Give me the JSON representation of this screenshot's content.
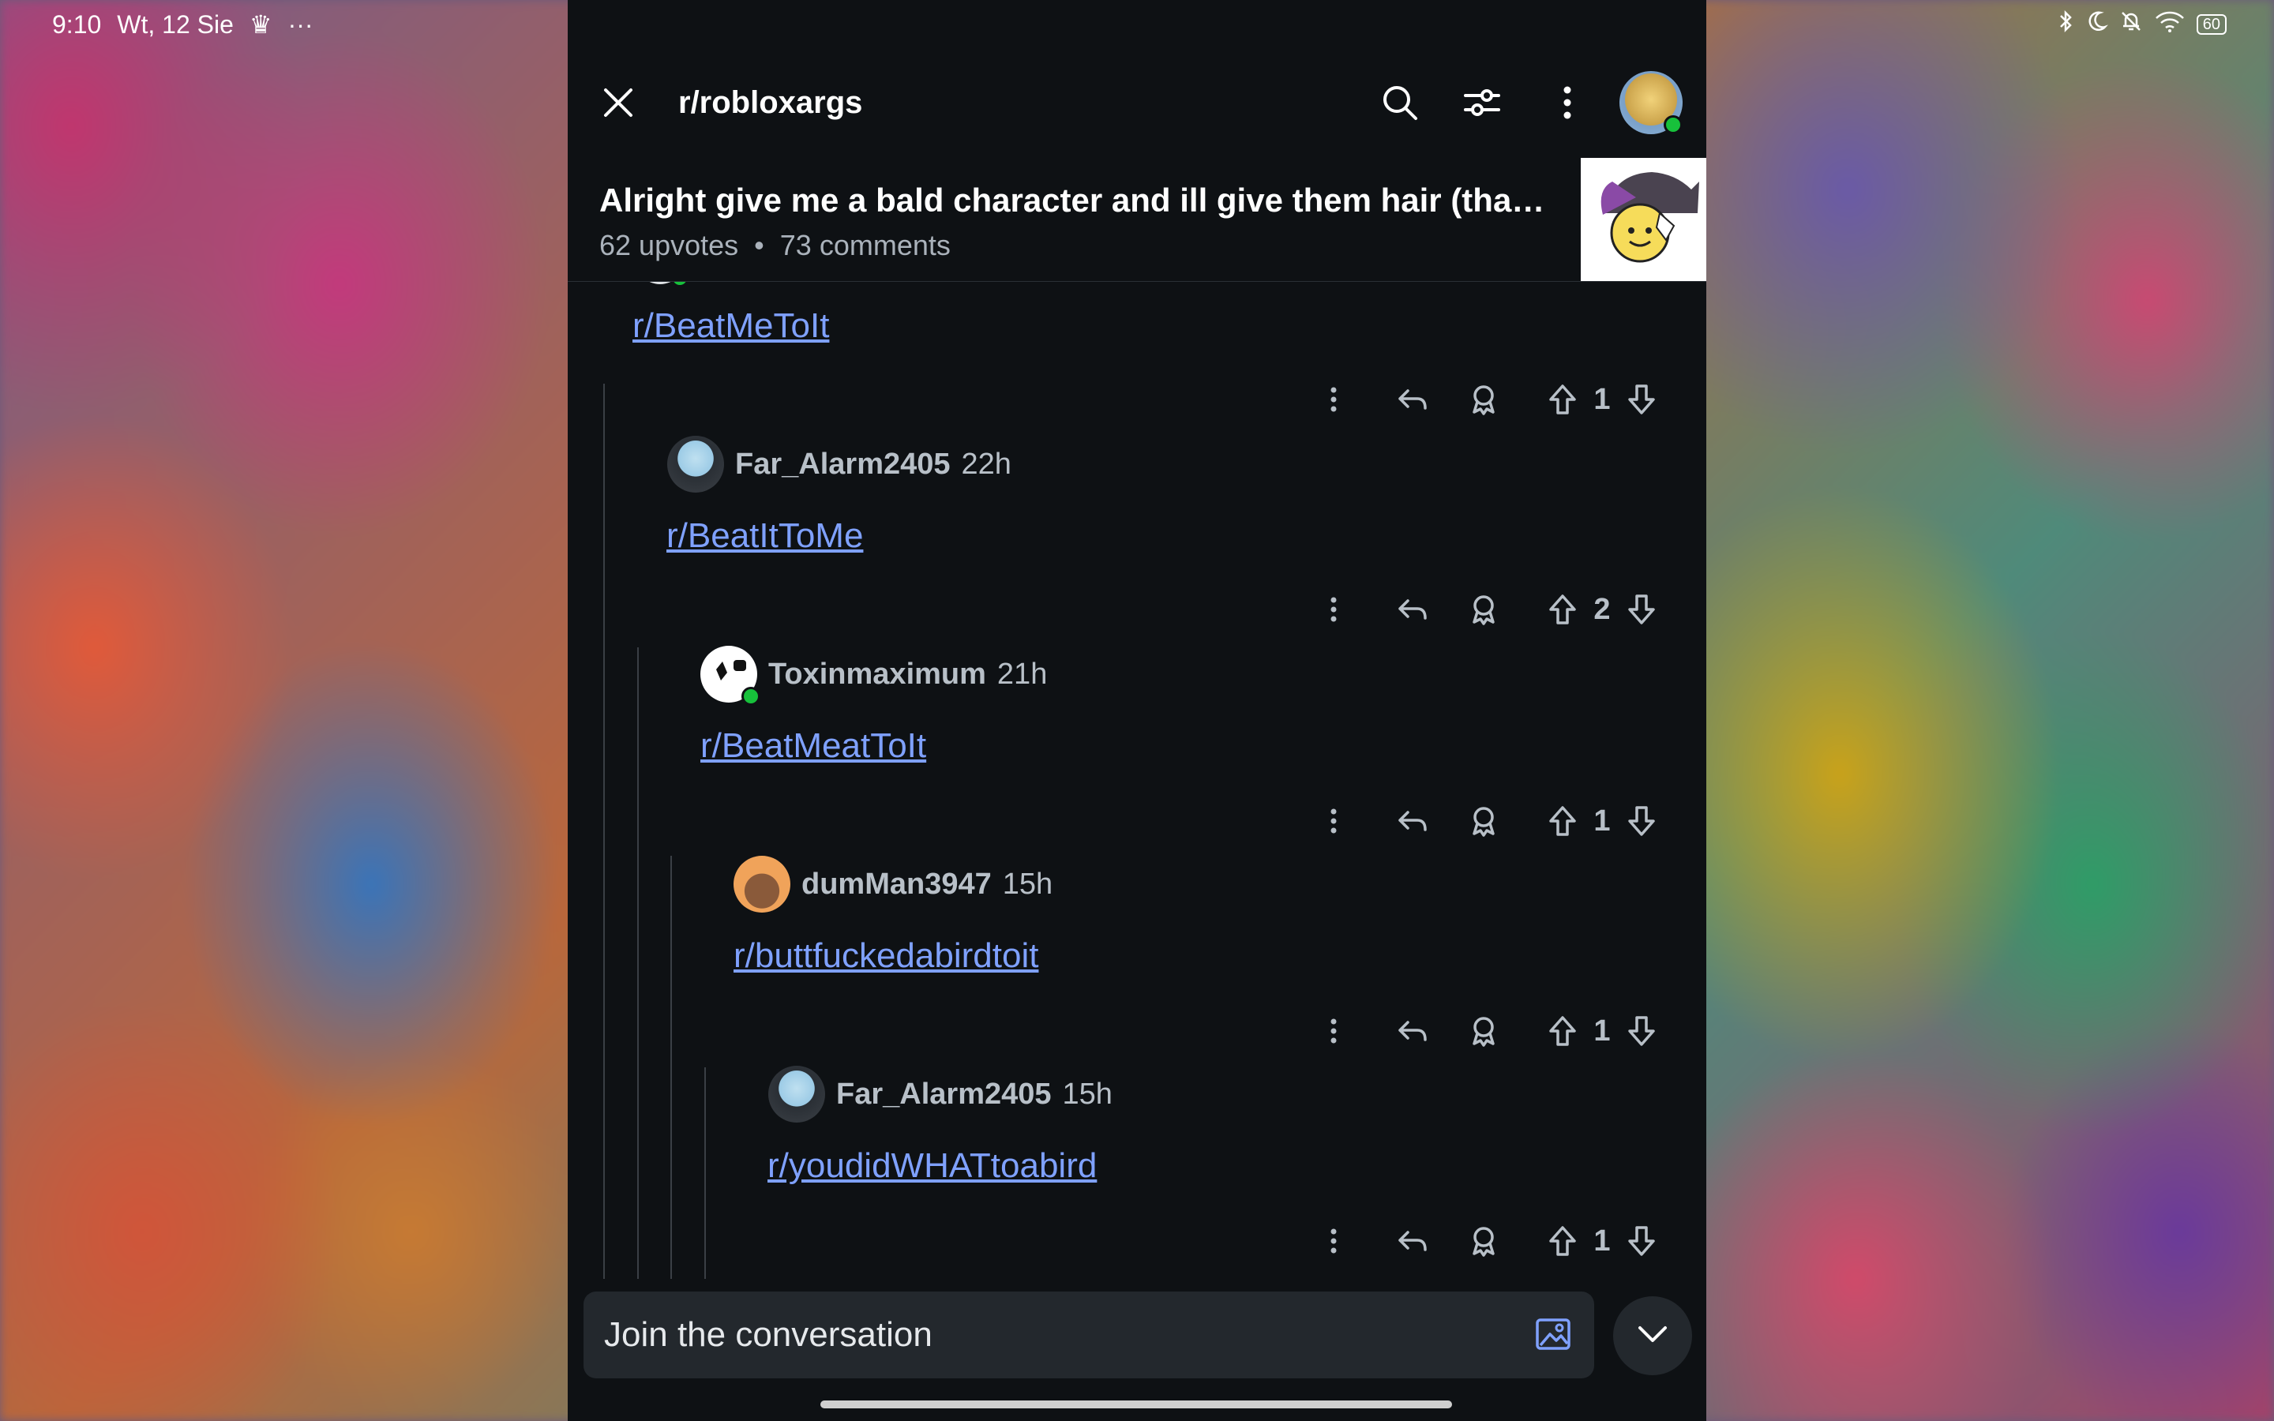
{
  "status_bar": {
    "time": "9:10",
    "date": "Wt, 12 Sie",
    "crown_icon": "crown-icon",
    "more": "···",
    "battery": "60"
  },
  "window": {
    "handle_dots": "•••"
  },
  "toolbar": {
    "subreddit": "r/robloxargs"
  },
  "post": {
    "title": "Alright give me a bald character and ill give them hair (tha…",
    "upvotes": "62 upvotes",
    "separator": "•",
    "comments": "73 comments"
  },
  "comments": [
    {
      "user": "",
      "time": "",
      "link": "r/BeatMeToIt",
      "votes": "1"
    },
    {
      "user": "Far_Alarm2405",
      "time": "22h",
      "link": "r/BeatItToMe",
      "votes": "2"
    },
    {
      "user": "Toxinmaximum",
      "time": "21h",
      "link": "r/BeatMeatToIt",
      "votes": "1"
    },
    {
      "user": "dumMan3947",
      "time": "15h",
      "link": "r/buttfuckedabirdtoit",
      "votes": "1"
    },
    {
      "user": "Far_Alarm2405",
      "time": "15h",
      "link": "r/youdidWHATtoabird",
      "votes": "1"
    }
  ],
  "compose": {
    "placeholder": "Join the conversation"
  },
  "colors": {
    "link": "#7fa1ff",
    "background": "#0e1114",
    "online": "#17c13b"
  }
}
